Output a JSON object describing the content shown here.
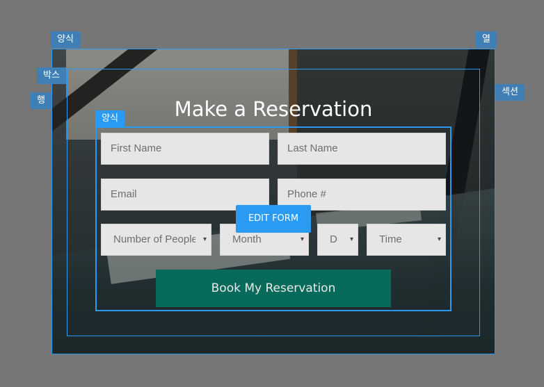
{
  "labels": {
    "form_outer": "양식",
    "column": "열",
    "box": "박스",
    "section": "섹션",
    "row": "행",
    "form_inner": "양식"
  },
  "form": {
    "title": "Make a Reservation",
    "first_name_placeholder": "First Name",
    "last_name_placeholder": "Last Name",
    "email_placeholder": "Email",
    "phone_placeholder": "Phone #",
    "people_placeholder": "Number of People",
    "month_placeholder": "Month",
    "day_placeholder": "D",
    "time_placeholder": "Time",
    "edit_button": "EDIT FORM",
    "submit_button": "Book My Reservation",
    "dropdown_glyph": "▾"
  },
  "colors": {
    "outline_accent": "#2b9af3",
    "tag_background": "#3f7fb6",
    "submit_background": "#086a5b",
    "canvas_background": "#767676"
  }
}
